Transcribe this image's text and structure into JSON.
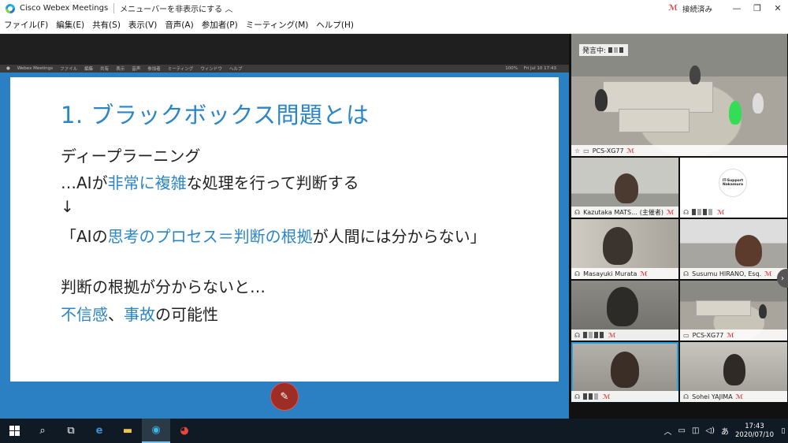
{
  "titlebar": {
    "app_name": "Cisco Webex Meetings",
    "menu_toggle": "メニューバーを非表示にする ︿",
    "status": "接続済み",
    "minimize": "—",
    "restore": "❐",
    "close": "✕"
  },
  "menu": [
    "ファイル(F)",
    "編集(E)",
    "共有(S)",
    "表示(V)",
    "音声(A)",
    "参加者(P)",
    "ミーティング(M)",
    "ヘルプ(H)"
  ],
  "shared_screen": {
    "mac_menu": [
      "",
      "Webex Meetings",
      "ファイル",
      "編集",
      "共有",
      "表示",
      "音声",
      "参加者",
      "ミーティング",
      "ウィンドウ",
      "ヘルプ"
    ],
    "mac_status": [
      "100%",
      "Fri Jul 10  17:43"
    ],
    "slide": {
      "title": "1. ブラックボックス問題とは",
      "line1": "ディープラーニング",
      "line2_a": "…AIが",
      "line2_b": "非常に複雑",
      "line2_c": "な処理を行って判断する",
      "line3": "↓",
      "line4_a": "「AIの",
      "line4_b": "思考のプロセス＝判断の根拠",
      "line4_c": "が人間には分からない」",
      "line5": "判断の根拠が分からないと…",
      "line6_a": "不信感",
      "line6_b": "、",
      "line6_c": "事故",
      "line6_d": "の可能性"
    }
  },
  "mute_icon": "🎙",
  "participants": {
    "speaking_label": "発言中:",
    "main_room": "PCS-XG77",
    "kazutaka": "Kazutaka MATS...",
    "host_tag": "(主催者)",
    "logo_text": "IT-Support Nakamura",
    "masayuki": "Masayuki Murata",
    "susumu": "Susumu HIRANO, Esq.",
    "room2": "PCS-XG77",
    "sohei": "Sohei YAJIMA",
    "mic_muted_icon": "🎙",
    "headset_icon": "🎧"
  },
  "taskbar": {
    "start_icon": "windows-logo",
    "search_icon": "⌕",
    "taskview_icon": "⧉",
    "ime": "あ",
    "time": "17:43",
    "date": "2020/07/10"
  },
  "colors": {
    "slide_blue": "#2b85c9",
    "share_border": "#2a80c3",
    "mute_red": "#9e2e25",
    "active_outline": "#29a3e0"
  }
}
